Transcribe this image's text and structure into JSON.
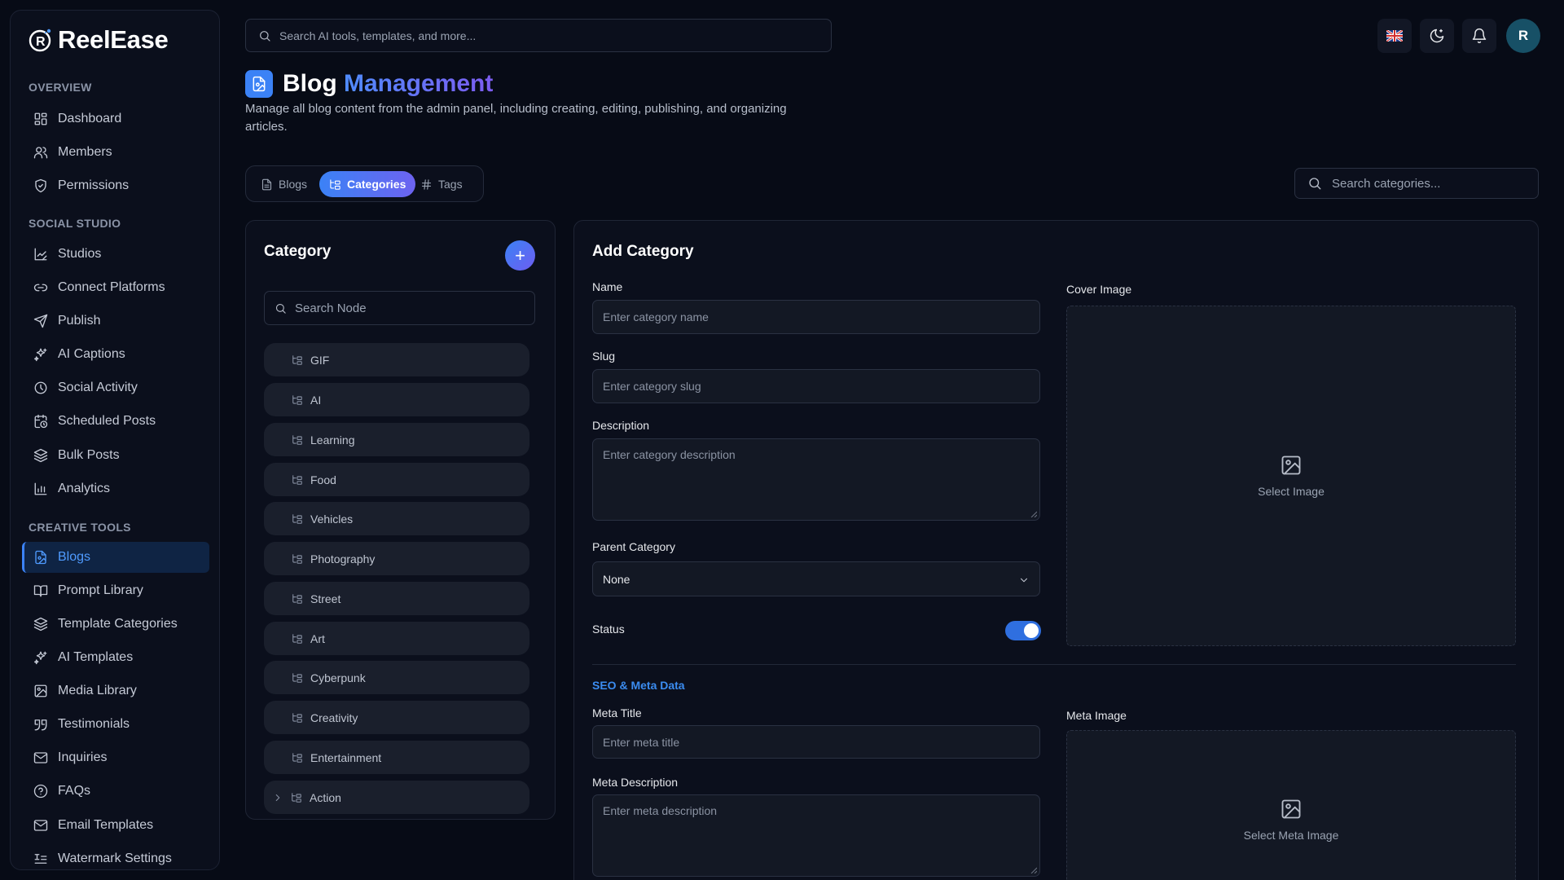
{
  "app": {
    "name": "ReelEase"
  },
  "sidebar": {
    "sections": [
      {
        "label": "OVERVIEW"
      },
      {
        "label": "SOCIAL STUDIO"
      },
      {
        "label": "CREATIVE TOOLS"
      }
    ],
    "items": [
      {
        "label": "Dashboard",
        "icon": "dashboard-icon"
      },
      {
        "label": "Members",
        "icon": "users-icon"
      },
      {
        "label": "Permissions",
        "icon": "shield-icon"
      },
      {
        "label": "Studios",
        "icon": "chart-edit-icon"
      },
      {
        "label": "Connect Platforms",
        "icon": "link-icon"
      },
      {
        "label": "Publish",
        "icon": "send-icon"
      },
      {
        "label": "AI Captions",
        "icon": "sparkles-icon"
      },
      {
        "label": "Social Activity",
        "icon": "clock-icon"
      },
      {
        "label": "Scheduled Posts",
        "icon": "calendar-clock-icon"
      },
      {
        "label": "Bulk Posts",
        "icon": "layers-icon"
      },
      {
        "label": "Analytics",
        "icon": "bar-chart-icon"
      },
      {
        "label": "Blogs",
        "icon": "file-image-icon",
        "active": true
      },
      {
        "label": "Prompt Library",
        "icon": "book-icon"
      },
      {
        "label": "Template Categories",
        "icon": "stack-icon"
      },
      {
        "label": "AI Templates",
        "icon": "sparkles-icon"
      },
      {
        "label": "Media Library",
        "icon": "image-icon"
      },
      {
        "label": "Testimonials",
        "icon": "quote-icon"
      },
      {
        "label": "Inquiries",
        "icon": "mail-icon"
      },
      {
        "label": "FAQs",
        "icon": "help-circle-icon"
      },
      {
        "label": "Email Templates",
        "icon": "mail-icon"
      },
      {
        "label": "Watermark Settings",
        "icon": "text-settings-icon"
      }
    ]
  },
  "topbar": {
    "search_placeholder": "Search AI tools, templates, and more...",
    "language_flag": "gb-flag-icon",
    "avatar_initial": "R"
  },
  "header": {
    "title_main": "Blog",
    "title_accent": "Management",
    "description": "Manage all blog content from the admin panel, including creating, editing, publishing, and organizing articles."
  },
  "tabs": [
    {
      "label": "Blogs"
    },
    {
      "label": "Categories",
      "active": true
    },
    {
      "label": "Tags"
    }
  ],
  "category_search_placeholder": "Search categories...",
  "category_panel": {
    "title": "Category",
    "add_label": "+",
    "search_placeholder": "Search Node",
    "nodes": [
      "GIF",
      "AI",
      "Learning",
      "Food",
      "Vehicles",
      "Photography",
      "Street",
      "Art",
      "Cyberpunk",
      "Creativity",
      "Entertainment",
      "Action"
    ]
  },
  "form": {
    "title": "Add Category",
    "name_label": "Name",
    "name_placeholder": "Enter category name",
    "slug_label": "Slug",
    "slug_placeholder": "Enter category slug",
    "description_label": "Description",
    "description_placeholder": "Enter category description",
    "parent_label": "Parent Category",
    "parent_value": "None",
    "status_label": "Status",
    "status_on": true,
    "cover_label": "Cover Image",
    "cover_button": "Select Image",
    "seo_title": "SEO & Meta Data",
    "meta_title_label": "Meta Title",
    "meta_title_placeholder": "Enter meta title",
    "meta_desc_label": "Meta Description",
    "meta_desc_placeholder": "Enter meta description",
    "meta_image_label": "Meta Image",
    "meta_image_button": "Select Meta Image"
  },
  "colors": {
    "accent": "#3b82f6",
    "accent_purple": "#6d63f0",
    "background": "#070b16",
    "panel": "#0b0f1c"
  }
}
